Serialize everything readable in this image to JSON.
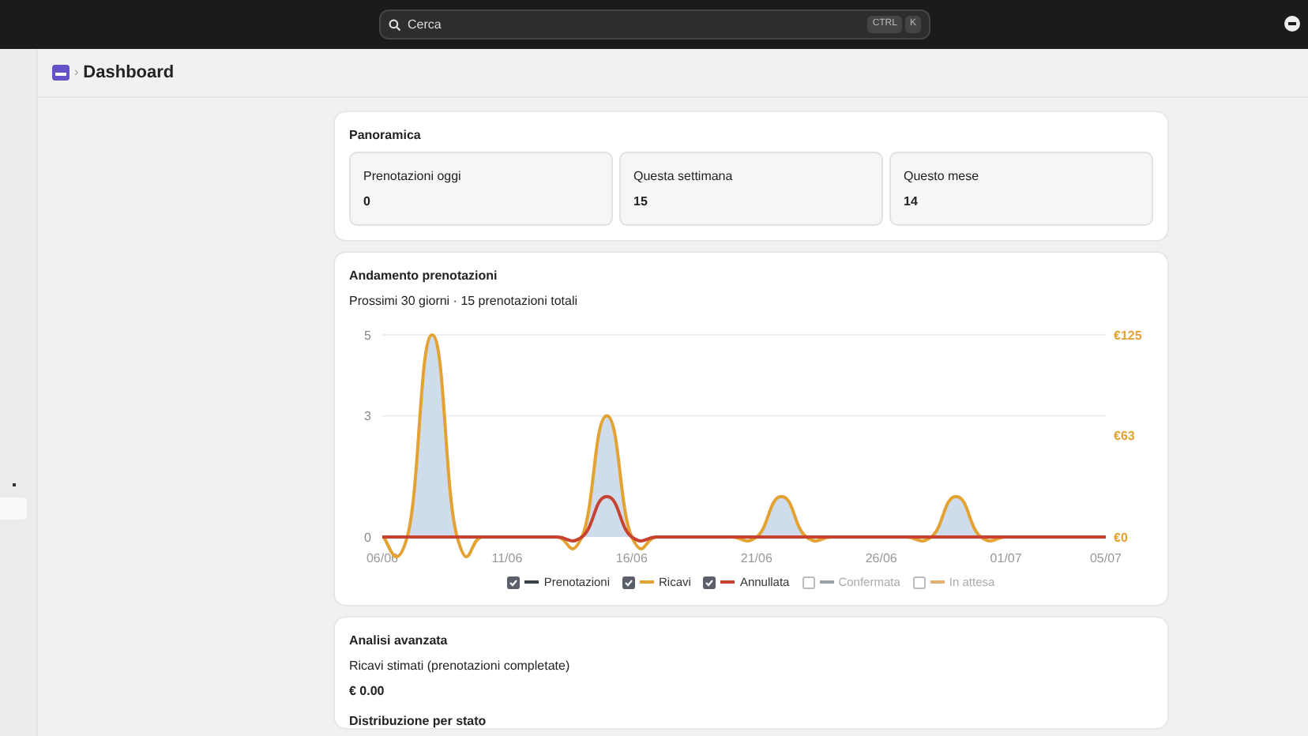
{
  "topbar": {
    "search": {
      "placeholder": "Cerca",
      "shortcut": [
        "CTRL",
        "K"
      ]
    }
  },
  "breadcrumb": {
    "separator": "›",
    "title": "Dashboard"
  },
  "overview": {
    "title": "Panoramica",
    "stats": [
      {
        "label": "Prenotazioni oggi",
        "value": "0"
      },
      {
        "label": "Questa settimana",
        "value": "15"
      },
      {
        "label": "Questo mese",
        "value": "14"
      }
    ]
  },
  "trend": {
    "title": "Andamento prenotazioni",
    "subtitle": "Prossimi 30 giorni · 15 prenotazioni totali",
    "chart_data": {
      "type": "line",
      "categories": [
        "06/06",
        null,
        null,
        null,
        null,
        "11/06",
        null,
        null,
        null,
        null,
        "16/06",
        null,
        null,
        null,
        null,
        "21/06",
        null,
        null,
        null,
        null,
        "26/06",
        null,
        null,
        null,
        null,
        "01/07",
        null,
        null,
        null,
        "05/07"
      ],
      "ylim": [
        0,
        5
      ],
      "yticks": [
        0,
        3,
        5
      ],
      "y2lim": [
        0,
        125
      ],
      "y2ticks": [
        {
          "value": 0,
          "label": "€0"
        },
        {
          "value": 63,
          "label": "€63"
        },
        {
          "value": 125,
          "label": "€125"
        }
      ],
      "series": [
        {
          "name": "Ricavi",
          "color": "#e3a232",
          "axis": "y2",
          "values": [
            0,
            0,
            125,
            0,
            0,
            0,
            0,
            0,
            0,
            75,
            0,
            0,
            0,
            0,
            0,
            0,
            25,
            0,
            0,
            0,
            0,
            0,
            0,
            25,
            0,
            0,
            0,
            null,
            null,
            null
          ]
        },
        {
          "name": "Annullata",
          "color": "#c8432f",
          "values": [
            0,
            0,
            0,
            0,
            0,
            0,
            0,
            0,
            0,
            1,
            0,
            0,
            0,
            0,
            0,
            0,
            0,
            0,
            0,
            0,
            0,
            0,
            0,
            0,
            0,
            0,
            0,
            0,
            0,
            0
          ]
        }
      ]
    },
    "legend": [
      {
        "label": "Prenotazioni",
        "color": "#3b3f4a",
        "checked": true
      },
      {
        "kind": "series",
        "checked": true
      },
      {
        "kind": "series",
        "checked": true
      },
      {
        "label": "Confermata",
        "color": "#9aa0a8",
        "checked": false
      },
      {
        "label": "In attesa",
        "color": "#e3b070",
        "checked": false
      }
    ]
  },
  "advanced": {
    "title": "Analisi avanzata",
    "revenue_label": "Ricavi stimati (prenotazioni completate)",
    "revenue_value": "€ 0.00",
    "distribution_title": "Distribuzione per stato"
  }
}
